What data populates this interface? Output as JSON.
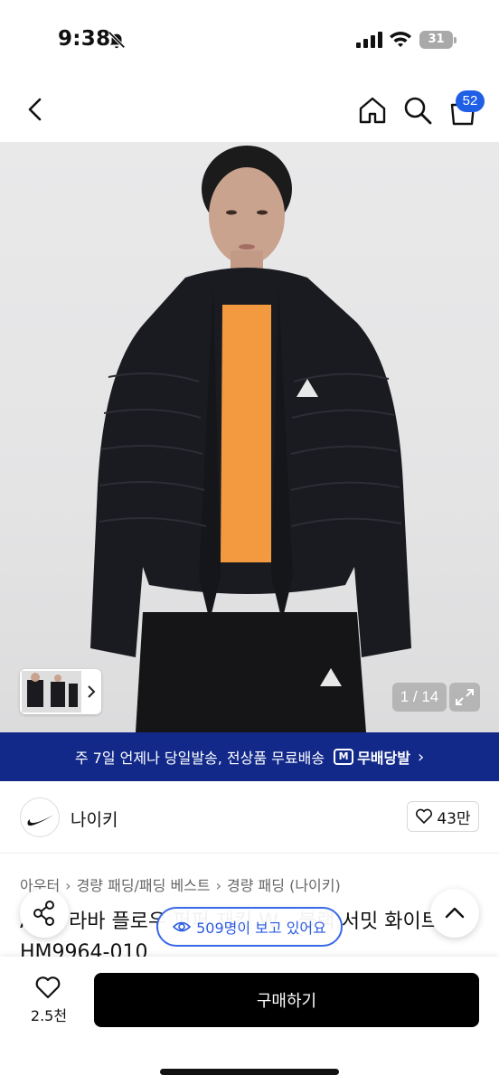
{
  "status": {
    "time": "9:38",
    "battery": "31"
  },
  "nav": {
    "cart_count": "52"
  },
  "gallery": {
    "counter": "1 / 14"
  },
  "shipping": {
    "text": "주 7일 언제나 당일발송, 전상품 무료배송",
    "logo_mark": "M",
    "logo_text": "무배당발",
    "chevron": "›"
  },
  "brand": {
    "name": "나이키",
    "likes": "43만"
  },
  "breadcrumb": [
    "아우터",
    "경량 패딩/패딩 베스트",
    "경량 패딩 (나이키)"
  ],
  "breadcrumb_sep": "›",
  "product": {
    "title": "ACG 라바 플로우 퍼퍼 재킷 W - 블랙:서밋 화이트 / HM9964-010"
  },
  "viewers": "509명이 보고 있어요",
  "bottom": {
    "wish_count": "2.5천",
    "buy_label": "구매하기"
  },
  "colors": {
    "banner": "#12298a",
    "accent": "#1f5fe6",
    "buy_button": "#000000"
  },
  "icons": [
    "back-icon",
    "home-icon",
    "search-icon",
    "cart-icon",
    "expand-icon",
    "heart-icon",
    "share-icon",
    "eye-icon",
    "chevron-up-icon",
    "bell-off-icon",
    "signal-icon",
    "wifi-icon"
  ]
}
